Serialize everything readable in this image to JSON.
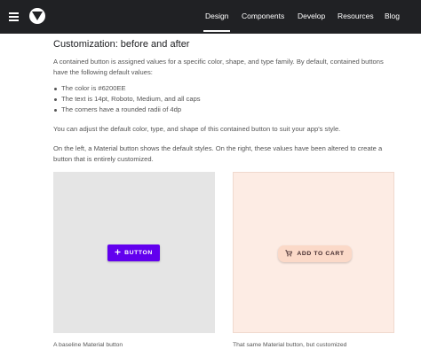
{
  "nav": {
    "items": [
      {
        "label": "Design",
        "active": true
      },
      {
        "label": "Components",
        "active": false
      },
      {
        "label": "Develop",
        "active": false
      },
      {
        "label": "Resources",
        "active": false
      },
      {
        "label": "Blog",
        "active": false
      }
    ]
  },
  "article": {
    "heading": "Customization: before and after",
    "intro": "A contained button is assigned values for a specific color, shape, and type family. By default, contained buttons have the following default values:",
    "bullets": [
      "The color is #6200EE",
      "The text is 14pt, Roboto, Medium, and all caps",
      "The corners have a rounded radii of 4dp"
    ],
    "adjust_text": "You can adjust the default color, type, and shape of this contained button to suit your app's style.",
    "compare_text": "On the left, a Material button shows the default styles. On the right, these values have been altered to create a button that is entirely customized."
  },
  "examples": {
    "default_button_label": "BUTTON",
    "custom_button_label": "ADD TO CART",
    "default_caption": "A baseline Material button",
    "custom_caption": "That same Material button, but customized"
  },
  "colors": {
    "topbar": "#202124",
    "default_button": "#6200ee",
    "custom_button": "#fbd9c8",
    "custom_panel": "#fdece4",
    "default_panel": "#e5e5e5"
  }
}
